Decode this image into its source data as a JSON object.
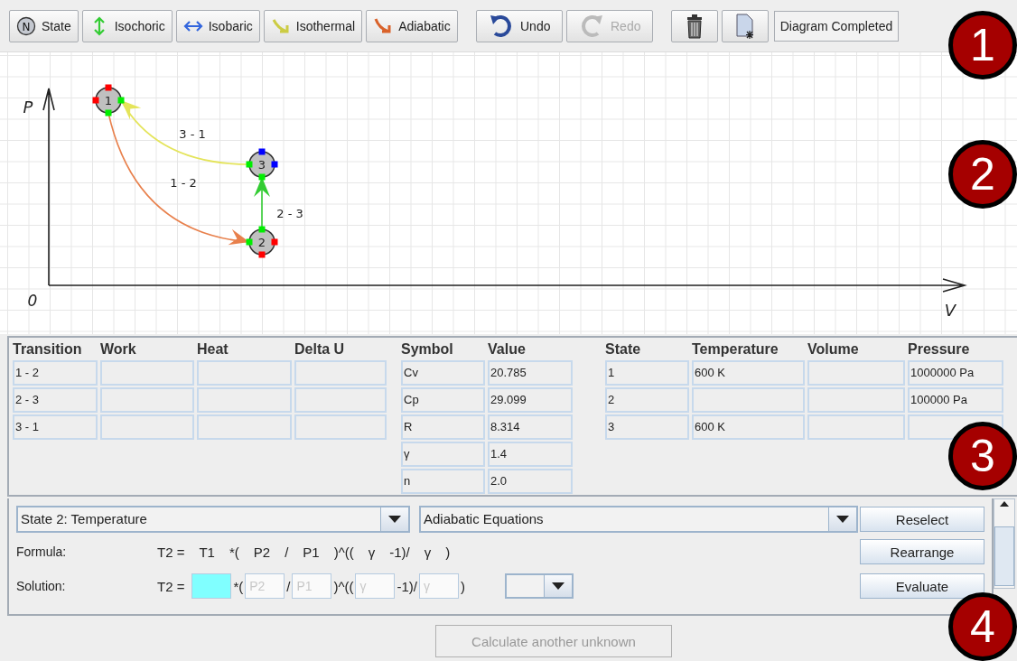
{
  "toolbar": {
    "tools": [
      {
        "kind": "state",
        "label": "State",
        "icon_text": "N"
      },
      {
        "kind": "isochoric",
        "label": "Isochoric"
      },
      {
        "kind": "isobaric",
        "label": "Isobaric"
      },
      {
        "kind": "isothermal",
        "label": "Isothermal"
      },
      {
        "kind": "adiabatic",
        "label": "Adiabatic"
      }
    ],
    "actions": [
      {
        "kind": "undo",
        "label": "Undo",
        "disabled": false
      },
      {
        "kind": "redo",
        "label": "Redo",
        "disabled": true
      }
    ],
    "icon_buttons": [
      {
        "kind": "trash"
      },
      {
        "kind": "new"
      }
    ],
    "status": "Diagram Completed"
  },
  "diagram": {
    "y_label": "P",
    "x_label": "V",
    "origin_label": "0",
    "states": [
      {
        "label": "1"
      },
      {
        "label": "2"
      },
      {
        "label": "3"
      }
    ],
    "transitions": [
      {
        "label": "1 - 2",
        "kind": "adiabatic"
      },
      {
        "label": "2 - 3",
        "kind": "isochoric"
      },
      {
        "label": "3 - 1",
        "kind": "isothermal"
      }
    ]
  },
  "transition_table": {
    "columns": [
      "Transition",
      "Work",
      "Heat",
      "Delta U"
    ],
    "rows": [
      {
        "transition": "1 - 2"
      },
      {
        "transition": "2 - 3"
      },
      {
        "transition": "3 - 1"
      }
    ]
  },
  "constants_table": {
    "columns": [
      "Symbol",
      "Value"
    ],
    "rows": [
      {
        "symbol": "Cv",
        "value": "20.785"
      },
      {
        "symbol": "Cp",
        "value": "29.099"
      },
      {
        "symbol": "R",
        "value": "8.314"
      },
      {
        "symbol": "γ",
        "value": "1.4"
      },
      {
        "symbol": "n",
        "value": "2.0"
      }
    ]
  },
  "state_table": {
    "columns": [
      "State",
      "Temperature",
      "Volume",
      "Pressure"
    ],
    "rows": [
      {
        "state": "1",
        "temperature": "600 K",
        "pressure": "1000000 Pa"
      },
      {
        "state": "2",
        "pressure": "100000 Pa"
      },
      {
        "state": "3",
        "temperature": "600 K"
      }
    ]
  },
  "equation_panel": {
    "unknown_select": "State 2: Temperature",
    "equation_select": "Adiabatic Equations",
    "formula_label": "Formula:",
    "formula": [
      "T2 =",
      "T1",
      "*(",
      "P2",
      "/",
      "P1",
      ")^((",
      "γ",
      "-1)/",
      "γ",
      ")"
    ],
    "solution_label": "Solution:",
    "solution": [
      {
        "kind": "text",
        "text": "T2 ="
      },
      {
        "kind": "field",
        "highlighted": true
      },
      {
        "kind": "text",
        "text": "*("
      },
      {
        "kind": "field",
        "placeholder": "P2",
        "highlighted": false
      },
      {
        "kind": "text",
        "text": "/"
      },
      {
        "kind": "field",
        "placeholder": "P1",
        "highlighted": false
      },
      {
        "kind": "text",
        "text": ")^(("
      },
      {
        "kind": "field",
        "placeholder": "γ",
        "highlighted": false
      },
      {
        "kind": "text",
        "text": "-1)/"
      },
      {
        "kind": "field",
        "placeholder": "γ",
        "highlighted": false
      },
      {
        "kind": "text",
        "text": ")"
      },
      {
        "kind": "select"
      }
    ],
    "buttons": [
      "Reselect",
      "Rearrange",
      "Evaluate"
    ]
  },
  "calculate_button": {
    "label": "Calculate another unknown",
    "disabled": true
  },
  "annotations": [
    {
      "label": "1"
    },
    {
      "label": "2"
    },
    {
      "label": "3"
    },
    {
      "label": "4"
    }
  ]
}
